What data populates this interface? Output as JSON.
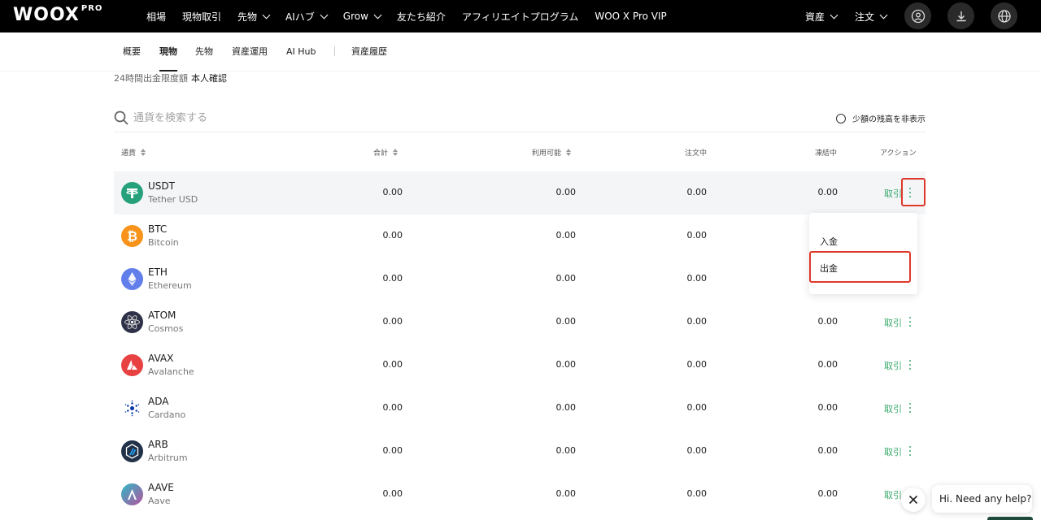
{
  "brand": {
    "logo": "WOOX",
    "logo_suffix": "PRO"
  },
  "topnav": {
    "items": [
      {
        "label": "相場",
        "dropdown": false
      },
      {
        "label": "現物取引",
        "dropdown": false
      },
      {
        "label": "先物",
        "dropdown": true
      },
      {
        "label": "AIハブ",
        "dropdown": true
      },
      {
        "label": "Grow",
        "dropdown": true
      },
      {
        "label": "友たち紹介",
        "dropdown": false
      },
      {
        "label": "アフィリエイトプログラム",
        "dropdown": false
      },
      {
        "label": "WOO X Pro VIP",
        "dropdown": false
      }
    ],
    "right": [
      {
        "label": "資産",
        "dropdown": true
      },
      {
        "label": "注文",
        "dropdown": true
      }
    ],
    "icons": [
      "user-icon",
      "download-icon",
      "globe-icon"
    ]
  },
  "subnav": {
    "tabs": [
      "概要",
      "現物",
      "先物",
      "資産運用",
      "AI Hub",
      "資産履歴"
    ],
    "active": "現物"
  },
  "limit": {
    "label": "24時間出金限度額",
    "value": "本人確認"
  },
  "search": {
    "placeholder": "通貨を検索する",
    "hide_small_label": "少額の残高を非表示"
  },
  "table": {
    "headers": {
      "currency": "通貨",
      "total": "合計",
      "available": "利用可能",
      "in_order": "注文中",
      "frozen": "凍結中",
      "action": "アクション"
    },
    "trade_label": "取引",
    "rows": [
      {
        "symbol": "USDT",
        "name": "Tether USD",
        "total": "0.00",
        "available": "0.00",
        "in_order": "0.00",
        "frozen": "0.00",
        "color": "#26a17b"
      },
      {
        "symbol": "BTC",
        "name": "Bitcoin",
        "total": "0.00",
        "available": "0.00",
        "in_order": "0.00",
        "frozen": "",
        "color": "#f7931a"
      },
      {
        "symbol": "ETH",
        "name": "Ethereum",
        "total": "0.00",
        "available": "0.00",
        "in_order": "0.00",
        "frozen": "",
        "color": "#627eea"
      },
      {
        "symbol": "ATOM",
        "name": "Cosmos",
        "total": "0.00",
        "available": "0.00",
        "in_order": "0.00",
        "frozen": "0.00",
        "color": "#2e3148"
      },
      {
        "symbol": "AVAX",
        "name": "Avalanche",
        "total": "0.00",
        "available": "0.00",
        "in_order": "0.00",
        "frozen": "0.00",
        "color": "#e84142"
      },
      {
        "symbol": "ADA",
        "name": "Cardano",
        "total": "0.00",
        "available": "0.00",
        "in_order": "0.00",
        "frozen": "0.00",
        "color": "#0033ad"
      },
      {
        "symbol": "ARB",
        "name": "Arbitrum",
        "total": "0.00",
        "available": "0.00",
        "in_order": "0.00",
        "frozen": "0.00",
        "color": "#213147"
      },
      {
        "symbol": "AAVE",
        "name": "Aave",
        "total": "0.00",
        "available": "0.00",
        "in_order": "0.00",
        "frozen": "0.00",
        "color": "#9c69b6"
      }
    ]
  },
  "dropdown": {
    "items": [
      "入金",
      "出金"
    ]
  },
  "chat": {
    "message": "Hi. Need any help?"
  }
}
